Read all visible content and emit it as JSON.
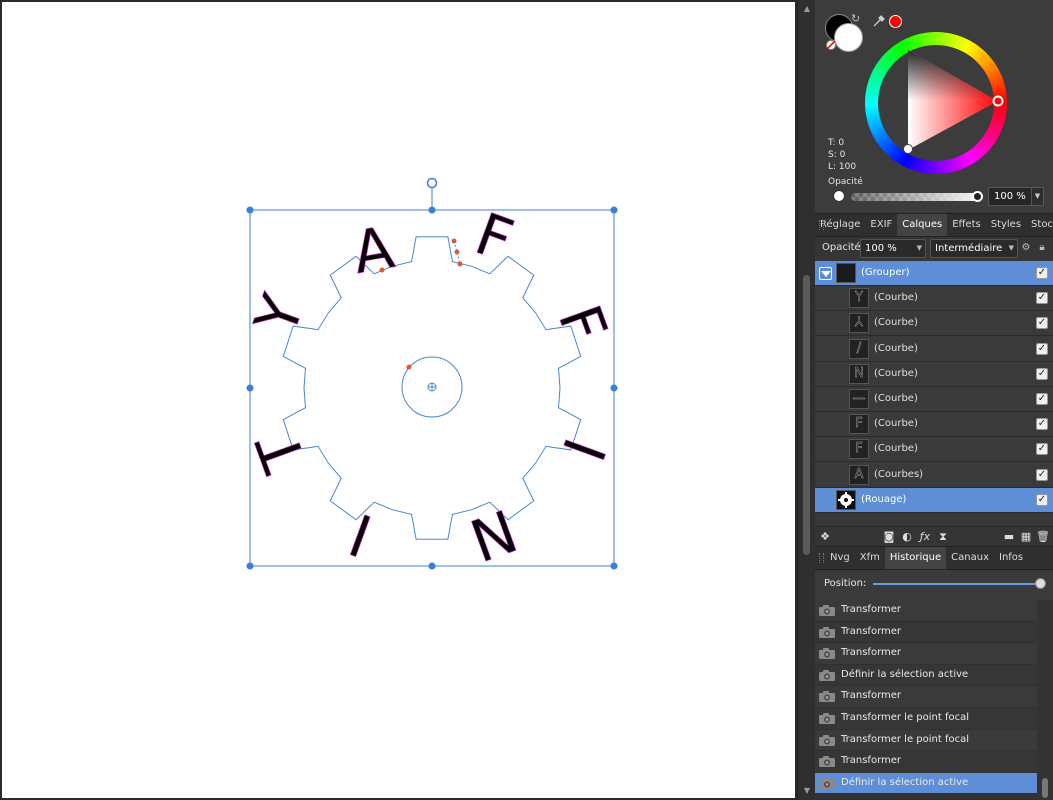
{
  "canvas": {
    "letters": [
      "A",
      "F",
      "F",
      "I",
      "N",
      "I",
      "T",
      "Y"
    ]
  },
  "color_panel": {
    "primary_color": "#000000",
    "secondary_color": "#ffffff",
    "picked_color": "#ff0000",
    "readout_t": "T: 0",
    "readout_s": "S: 0",
    "readout_l": "L: 100",
    "opacity_label": "Opacité",
    "opacity_value": "100 %"
  },
  "top_tabs": [
    {
      "label": "Réglage",
      "active": false
    },
    {
      "label": "EXIF",
      "active": false
    },
    {
      "label": "Calques",
      "active": true
    },
    {
      "label": "Effets",
      "active": false
    },
    {
      "label": "Styles",
      "active": false
    },
    {
      "label": "Stock",
      "active": false
    }
  ],
  "layers_toolbar": {
    "opacity_label": "Opacité:",
    "opacity_value": "100 %",
    "blend_mode": "Intermédiaire"
  },
  "layers": [
    {
      "name": "(Grouper)",
      "selected": true,
      "indent": false,
      "visible": true
    },
    {
      "name": "(Courbe)",
      "selected": false,
      "indent": true,
      "visible": true
    },
    {
      "name": "(Courbe)",
      "selected": false,
      "indent": true,
      "visible": true
    },
    {
      "name": "(Courbe)",
      "selected": false,
      "indent": true,
      "visible": true
    },
    {
      "name": "(Courbe)",
      "selected": false,
      "indent": true,
      "visible": true
    },
    {
      "name": "(Courbe)",
      "selected": false,
      "indent": true,
      "visible": true
    },
    {
      "name": "(Courbe)",
      "selected": false,
      "indent": true,
      "visible": true
    },
    {
      "name": "(Courbe)",
      "selected": false,
      "indent": true,
      "visible": true
    },
    {
      "name": "(Courbes)",
      "selected": false,
      "indent": true,
      "visible": true
    },
    {
      "name": "(Rouage)",
      "selected": true,
      "indent": false,
      "visible": true
    }
  ],
  "bottom_tabs": [
    {
      "label": "Nvg",
      "active": false
    },
    {
      "label": "Xfm",
      "active": false
    },
    {
      "label": "Historique",
      "active": true
    },
    {
      "label": "Canaux",
      "active": false
    },
    {
      "label": "Infos",
      "active": false
    }
  ],
  "history": {
    "position_label": "Position:",
    "position_value": 1.0,
    "items": [
      {
        "label": "Transformer",
        "selected": false
      },
      {
        "label": "Transformer",
        "selected": false
      },
      {
        "label": "Transformer",
        "selected": false
      },
      {
        "label": "Définir la sélection active",
        "selected": false
      },
      {
        "label": "Transformer",
        "selected": false
      },
      {
        "label": "Transformer le point focal",
        "selected": false
      },
      {
        "label": "Transformer le point focal",
        "selected": false
      },
      {
        "label": "Transformer",
        "selected": false
      },
      {
        "label": "Définir la sélection active",
        "selected": true
      }
    ]
  },
  "colors": {
    "accent": "#5d8ed6",
    "selection": "#3d7ed8",
    "handle_red": "#e05a30"
  }
}
